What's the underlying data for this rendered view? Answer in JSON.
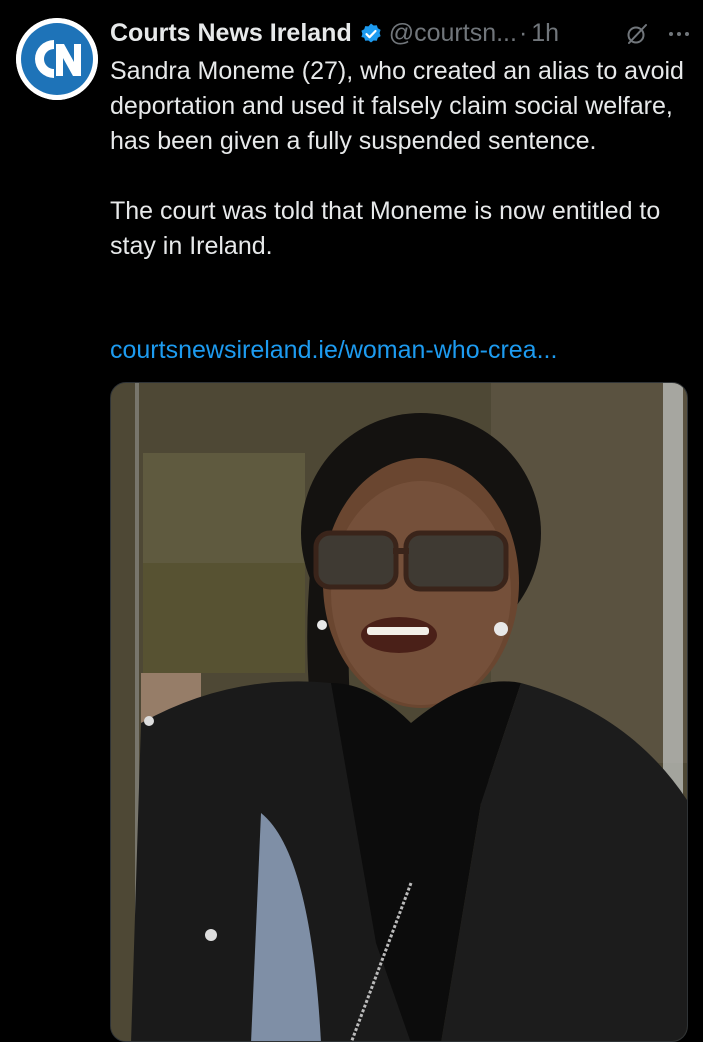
{
  "tweet": {
    "avatar_icon": "courts-news-ireland-logo",
    "display_name": "Courts News Ireland",
    "verified_icon": "verified-badge-icon",
    "handle": "@courtsn...",
    "separator": "·",
    "timestamp": "1h",
    "grok_icon": "grok-icon",
    "more_icon": "more-options-icon",
    "text_paragraph_1": "Sandra Moneme (27), who created an alias to avoid deportation and used it falsely claim social welfare, has been given a fully suspended sentence.",
    "text_paragraph_2": "The court was told that Moneme is now entitled to stay in Ireland.",
    "link": "courtsnewsireland.ie/woman-who-crea...",
    "media": {
      "type": "photo"
    }
  },
  "colors": {
    "background": "#000000",
    "text": "#e7e9ea",
    "secondary_text": "#71767b",
    "link": "#1d9bf0",
    "verified": "#1d9bf0",
    "logo_blue": "#1e73b8"
  }
}
